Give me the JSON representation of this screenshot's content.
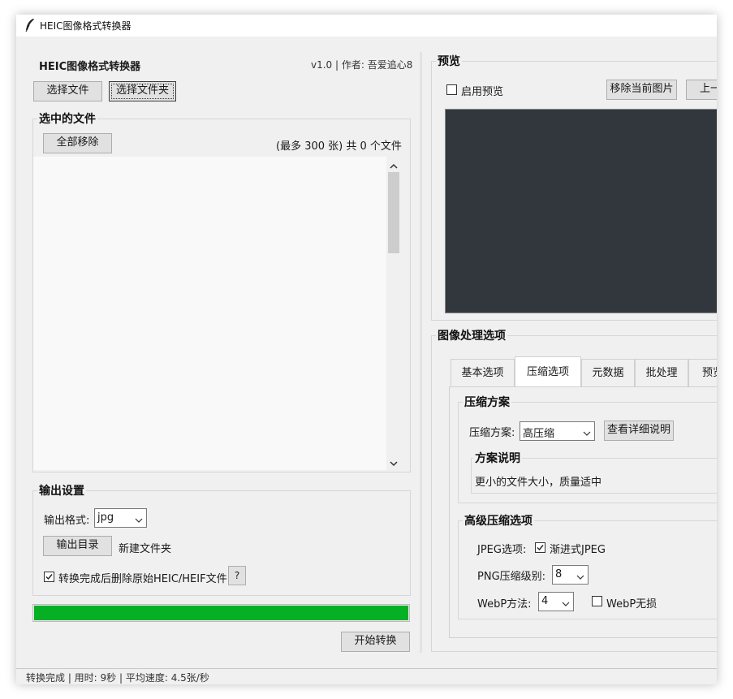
{
  "window": {
    "title": "HEIC图像格式转换器"
  },
  "header": {
    "app_name": "HEIC图像格式转换器",
    "version_author": "v1.0 | 作者: 吾爱追心8"
  },
  "file_buttons": {
    "select_files": "选择文件",
    "select_folder": "选择文件夹"
  },
  "selected_files": {
    "title": "选中的文件",
    "remove_all": "全部移除",
    "count_text": "(最多 300 张) 共 0 个文件"
  },
  "output": {
    "title": "输出设置",
    "format_label": "输出格式:",
    "format_value": "jpg",
    "dir_button": "输出目录",
    "dir_value": "新建文件夹",
    "delete_original_label": "转换完成后删除原始HEIC/HEIF文件",
    "delete_original_checked": true,
    "help_button": "?"
  },
  "progress": {
    "value": 1.0,
    "color": "#06b025"
  },
  "start_button": "开始转换",
  "preview": {
    "title": "预览",
    "enable_label": "启用预览",
    "enable_checked": false,
    "remove_current": "移除当前图片",
    "prev_partial": "上一"
  },
  "processing": {
    "title": "图像处理选项",
    "tabs": [
      {
        "label": "基本选项",
        "active": false
      },
      {
        "label": "压缩选项",
        "active": true
      },
      {
        "label": "元数据",
        "active": false
      },
      {
        "label": "批处理",
        "active": false
      },
      {
        "label": "预览",
        "active": false
      }
    ],
    "compression": {
      "section_title": "压缩方案",
      "scheme_label": "压缩方案:",
      "scheme_value": "高压缩",
      "details_button": "查看详细说明",
      "desc_title": "方案说明",
      "desc_text": "更小的文件大小，质量适中"
    },
    "advanced": {
      "section_title": "高级压缩选项",
      "jpeg_label": "JPEG选项:",
      "progressive_label": "渐进式JPEG",
      "progressive_checked": true,
      "png_label": "PNG压缩级别:",
      "png_value": "8",
      "webp_label": "WebP方法:",
      "webp_value": "4",
      "webp_lossless_label": "WebP无损",
      "webp_lossless_checked": false
    }
  },
  "status_bar": {
    "text": "转换完成 | 用时: 9秒 | 平均速度: 4.5张/秒"
  }
}
